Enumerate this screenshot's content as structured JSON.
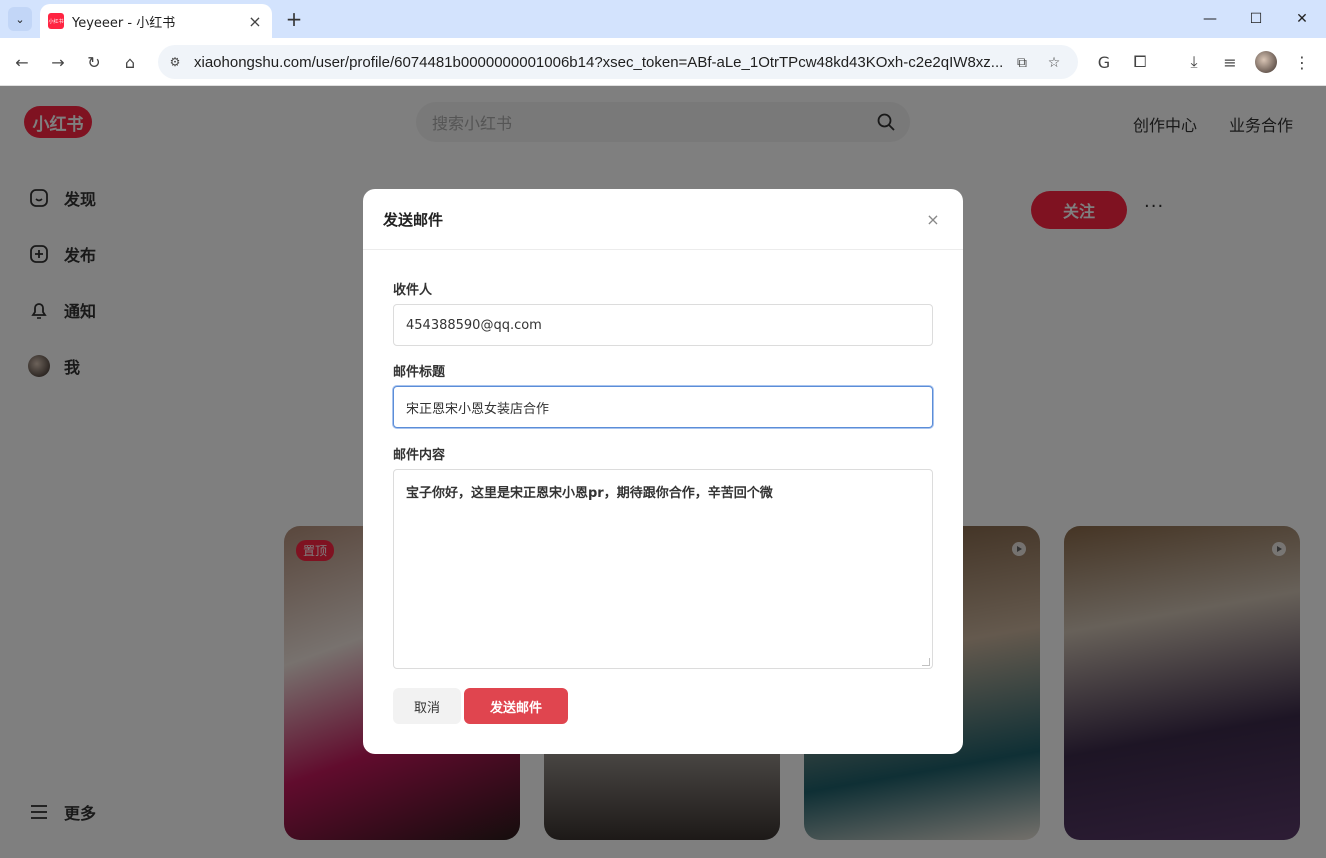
{
  "browser": {
    "tab_title": "Yeyeeer - 小红书",
    "url": "xiaohongshu.com/user/profile/6074481b0000000001006b14?xsec_token=ABf-aLe_1OtrTPcw48kd43KOxh-c2e2qIW8xz..."
  },
  "site": {
    "logo_text": "小红书",
    "search_placeholder": "搜索小红书",
    "top_links": [
      "创作中心",
      "业务合作"
    ],
    "nav": [
      {
        "label": "发现",
        "icon": "discover-icon"
      },
      {
        "label": "发布",
        "icon": "publish-icon"
      },
      {
        "label": "通知",
        "icon": "bell-icon"
      },
      {
        "label": "我",
        "icon": "avatar"
      }
    ],
    "more_label": "更多",
    "follow_label": "关注",
    "pinned_badge": "置顶"
  },
  "modal": {
    "title": "发送邮件",
    "recipient_label": "收件人",
    "recipient_value": "454388590@qq.com",
    "subject_label": "邮件标题",
    "subject_value": "宋正恩宋小恩女装店合作",
    "content_label": "邮件内容",
    "content_value": "宝子你好，这里是宋正恩宋小恩pr，期待跟你合作，辛苦回个微",
    "cancel_label": "取消",
    "send_label": "发送邮件"
  },
  "colors": {
    "brand": "#ff2442",
    "send_button": "#e0454f",
    "focus_border": "#5b8dd8"
  }
}
